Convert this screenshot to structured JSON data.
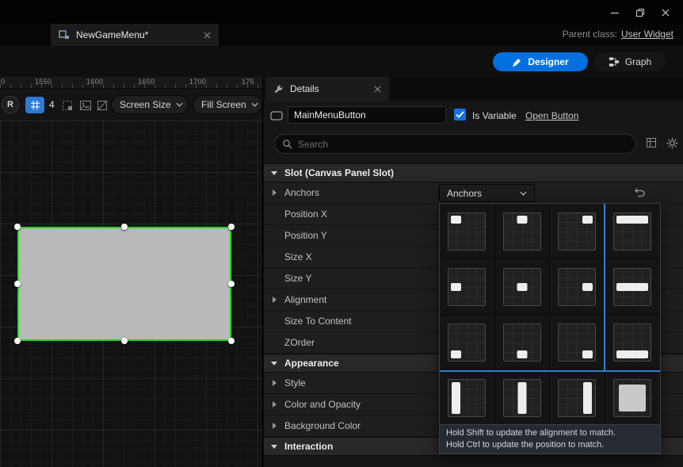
{
  "titlebar": {
    "parent_class_label": "Parent class:",
    "parent_class_value": "User Widget"
  },
  "asset_tab": {
    "title": "NewGameMenu*"
  },
  "mode_bar": {
    "designer_label": "Designer",
    "graph_label": "Graph"
  },
  "canvas": {
    "ruler_edge_tick": "0",
    "ruler_ticks": [
      "1550",
      "1600",
      "1650",
      "1700",
      "175"
    ],
    "r_button_label": "R",
    "grid_snap_size": "4",
    "screen_size_dropdown": "Screen Size",
    "fill_screen_dropdown": "Fill Screen"
  },
  "details": {
    "tab_title": "Details",
    "name_value": "MainMenuButton",
    "is_variable_label": "Is Variable",
    "open_button_label": "Open Button",
    "search_placeholder": "Search",
    "anchors_dropdown_value": "Anchors",
    "slot_section": {
      "title": "Slot (Canvas Panel Slot)",
      "rows": [
        {
          "label": "Anchors"
        },
        {
          "label": "Position X"
        },
        {
          "label": "Position Y"
        },
        {
          "label": "Size X"
        },
        {
          "label": "Size Y"
        },
        {
          "label": "Alignment"
        },
        {
          "label": "Size To Content"
        },
        {
          "label": "ZOrder"
        }
      ]
    },
    "appearance_section": {
      "title": "Appearance",
      "rows": [
        {
          "label": "Style"
        },
        {
          "label": "Color and Opacity"
        },
        {
          "label": "Background Color"
        }
      ]
    },
    "interaction_section": {
      "title": "Interaction"
    }
  },
  "anchor_popup": {
    "presets": [
      "top-left",
      "top-center",
      "top-right",
      "stretch-top",
      "center-left",
      "center-center",
      "center-right",
      "stretch-center",
      "bottom-left",
      "bottom-center",
      "bottom-right",
      "stretch-bottom",
      "stretch-left",
      "stretch-vertical-center",
      "stretch-right",
      "stretch-full"
    ],
    "hint_line1": "Hold Shift to update the alignment to match.",
    "hint_line2": "Hold Ctrl to update the position to match."
  },
  "colors": {
    "accent_blue": "#0070e0",
    "selection_green": "#23d823",
    "widget_fill": "#b9b9b9",
    "anchor_guide_blue": "#2f7fd6"
  }
}
